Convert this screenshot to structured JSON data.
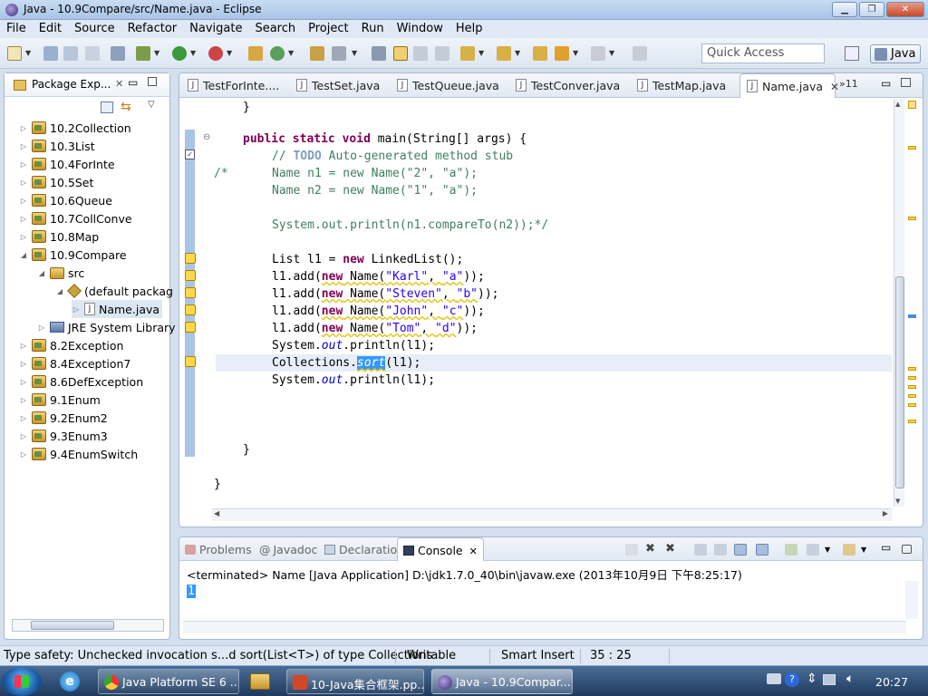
{
  "window": {
    "title": "Java - 10.9Compare/src/Name.java - Eclipse"
  },
  "menu": [
    "File",
    "Edit",
    "Source",
    "Refactor",
    "Navigate",
    "Search",
    "Project",
    "Run",
    "Window",
    "Help"
  ],
  "toolbar": {
    "quick_access_placeholder": "Quick Access",
    "perspective": "Java"
  },
  "package_explorer": {
    "title": "Package Exp...",
    "items": [
      {
        "label": "10.2Collection"
      },
      {
        "label": "10.3List"
      },
      {
        "label": "10.4ForInte"
      },
      {
        "label": "10.5Set"
      },
      {
        "label": "10.6Queue"
      },
      {
        "label": "10.7CollConve"
      },
      {
        "label": "10.8Map"
      },
      {
        "label": "10.9Compare"
      },
      {
        "label": "src"
      },
      {
        "label": "(default packag"
      },
      {
        "label": "Name.java"
      },
      {
        "label": "JRE System Library"
      },
      {
        "label": "8.2Exception"
      },
      {
        "label": "8.4Exception7"
      },
      {
        "label": "8.6DefException"
      },
      {
        "label": "9.1Enum"
      },
      {
        "label": "9.2Enum2"
      },
      {
        "label": "9.3Enum3"
      },
      {
        "label": "9.4EnumSwitch"
      }
    ]
  },
  "editor": {
    "tabs": [
      "TestForInte....",
      "TestSet.java",
      "TestQueue.java",
      "TestConver.java",
      "TestMap.java",
      "Name.java"
    ],
    "overflow": "»11",
    "code": {
      "brace1": "}",
      "kw_public": "public",
      "kw_static": "static",
      "kw_void": "void",
      "main_sig": " main(String[] args) {",
      "todo_prefix": "// ",
      "todo": "TODO",
      "todo_rest": " Auto-generated method stub",
      "comment_open": "/*",
      "n1": "Name n1 = new Name(\"2\", \"a\");",
      "n2": "Name n2 = new Name(\"1\", \"a\");",
      "println_cmp": "System.out.println(n1.compareTo(n2));*/",
      "list_decl_a": "List l1 = ",
      "kw_new": "new",
      "list_decl_b": " LinkedList();",
      "add_a": "l1.add(",
      "name_open": " Name(",
      "s_karl": "\"Karl\"",
      "s_a": "\"a\"",
      "s_steven": "\"Steven\"",
      "s_b": "\"b\"",
      "s_john": "\"John\"",
      "s_c": "\"c\"",
      "s_tom": "\"Tom\"",
      "s_d": "\"d\"",
      "comma": ", ",
      "close": "));",
      "sysout_a": "System.",
      "out": "out",
      "sysout_b": ".println(l1);",
      "coll_a": "Collections.",
      "sort": "sort",
      "coll_b": "(l1);",
      "brace2": "}",
      "brace3": "}"
    }
  },
  "console": {
    "tabs": {
      "problems": "Problems",
      "javadoc": "Javadoc",
      "declaration": "Declaration",
      "console": "Console"
    },
    "status": "<terminated> Name [Java Application] D:\\jdk1.7.0_40\\bin\\javaw.exe (2013年10月9日 下午8:25:17)",
    "output": "1"
  },
  "statusbar": {
    "message": "Type safety: Unchecked invocation s...d sort(List<T>) of type Collections",
    "writable": "Writable",
    "insert_mode": "Smart Insert",
    "position": "35 : 25"
  },
  "taskbar": {
    "items": [
      "Java Platform SE 6 ...",
      "10-Java集合框架.pp...",
      "Java - 10.9Compar..."
    ],
    "clock": "20:27"
  }
}
